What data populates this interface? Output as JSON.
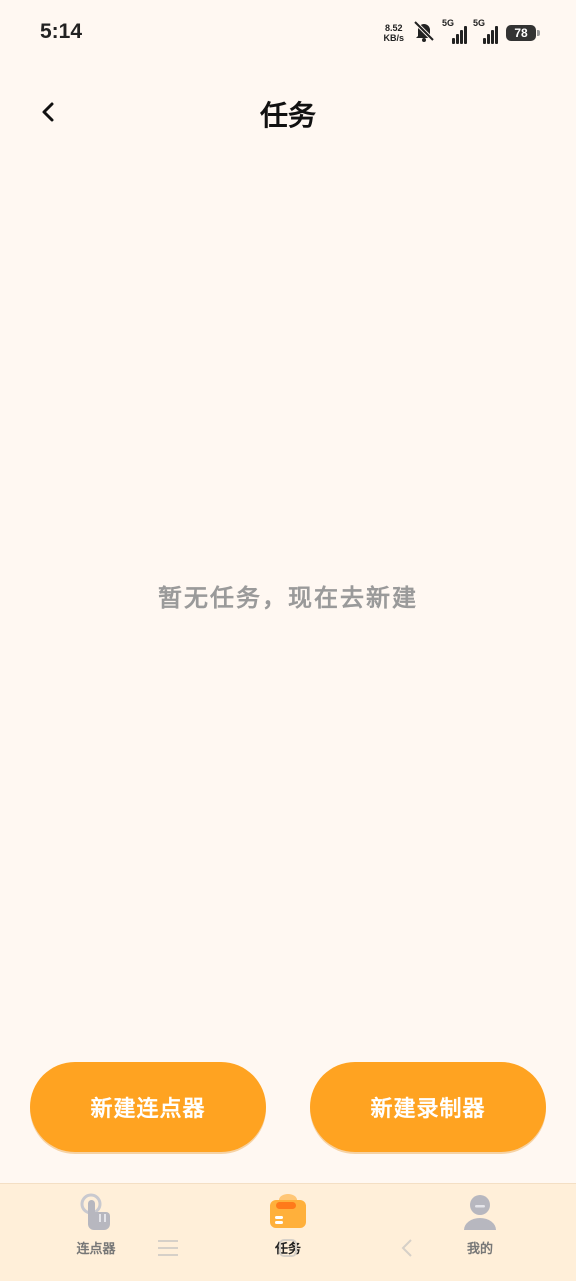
{
  "status_bar": {
    "time": "5:14",
    "net_speed_value": "8.52",
    "net_speed_unit": "KB/s",
    "sim1_label": "5G",
    "sim2_label": "5G",
    "battery": "78"
  },
  "header": {
    "title": "任务"
  },
  "empty_state": {
    "message": "暂无任务，现在去新建"
  },
  "actions": {
    "new_clicker": "新建连点器",
    "new_recorder": "新建录制器"
  },
  "bottom_nav": {
    "items": [
      {
        "label": "连点器",
        "icon": "tap-finger-icon",
        "active": false
      },
      {
        "label": "任务",
        "icon": "task-folder-icon",
        "active": true
      },
      {
        "label": "我的",
        "icon": "user-profile-icon",
        "active": false
      }
    ]
  },
  "colors": {
    "background": "#FFF8F2",
    "accent": "#FFA321",
    "nav_background": "#FFEFD9",
    "muted_text": "#9A9A9A"
  }
}
